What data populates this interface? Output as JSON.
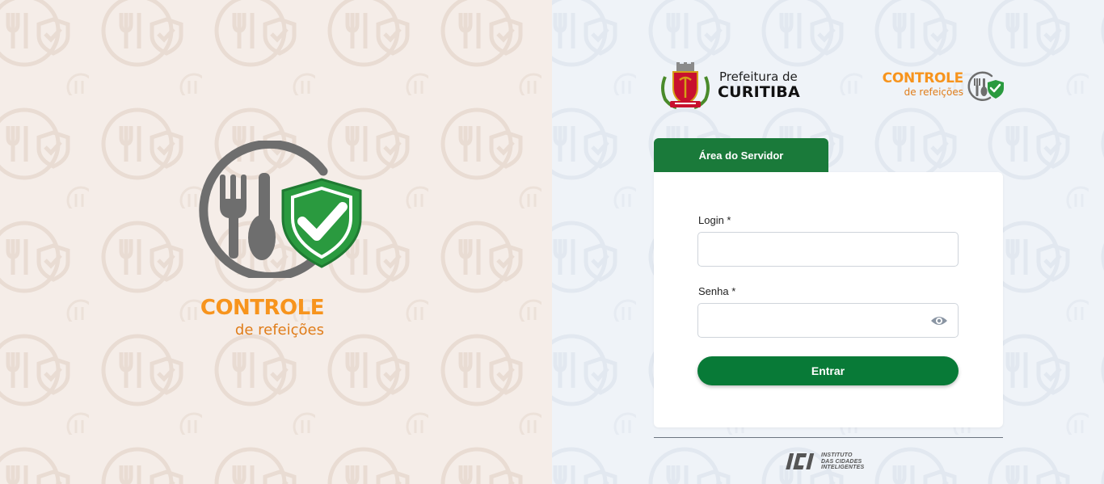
{
  "colors": {
    "brand_green": "#1a7a3a",
    "button_green": "#087a37",
    "brand_orange": "#f7941d",
    "icon_gray": "#6e6e6e",
    "left_background": "#f5ede8",
    "right_background": "#eff3f8"
  },
  "hero": {
    "icon": "controle-refeicoes-icon",
    "title": "CONTROLE",
    "subtitle": "de refeições"
  },
  "header": {
    "prefeitura": {
      "crest_icon": "curitiba-crest-icon",
      "line1": "Prefeitura de",
      "line2": "CURITIBA"
    },
    "app_logo": {
      "icon": "controle-refeicoes-icon",
      "title": "CONTROLE",
      "subtitle": "de refeições"
    }
  },
  "login_form": {
    "tab_label": "Área do Servidor",
    "login_label": "Login *",
    "login_value": "",
    "password_label": "Senha *",
    "password_value": "",
    "show_password_icon": "eye-icon",
    "submit_label": "Entrar"
  },
  "footer": {
    "mark": "ICI",
    "lines": [
      "INSTITUTO",
      "DAS CIDADES",
      "INTELIGENTES"
    ]
  }
}
